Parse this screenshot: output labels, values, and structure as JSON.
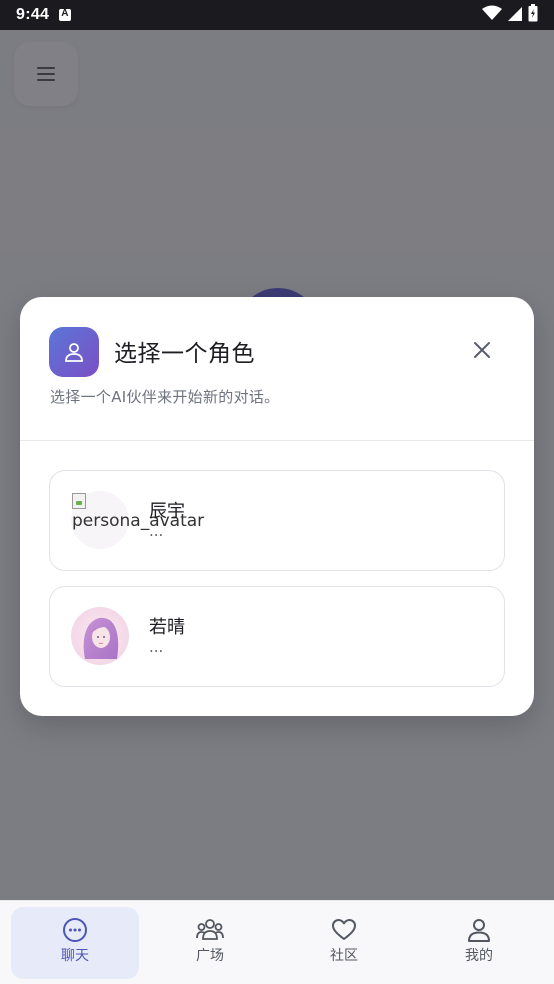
{
  "status_bar": {
    "time": "9:44",
    "icons": [
      "notification-a-icon",
      "wifi-icon",
      "signal-icon",
      "battery-icon"
    ]
  },
  "dialog": {
    "title": "选择一个角色",
    "subtitle": "选择一个AI伙伴来开始新的对话。",
    "icon": "person-icon",
    "close_icon": "close-icon",
    "personas": [
      {
        "name": "辰宇",
        "description": "...",
        "avatar_alt": "persona_avatar",
        "avatar_state": "broken-image"
      },
      {
        "name": "若晴",
        "description": "...",
        "avatar_state": "loaded-illustration"
      }
    ]
  },
  "bottom_nav": {
    "items": [
      {
        "label": "聊天",
        "icon": "chat-bubble-icon",
        "active": true
      },
      {
        "label": "广场",
        "icon": "group-icon",
        "active": false
      },
      {
        "label": "社区",
        "icon": "heart-icon",
        "active": false
      },
      {
        "label": "我的",
        "icon": "profile-icon",
        "active": false
      }
    ]
  },
  "colors": {
    "accent": "#4d55b4",
    "dialog_icon_gradient_start": "#5b76d6",
    "dialog_icon_gradient_end": "#7b4fc4",
    "overlay": "rgba(20,20,26,0.52)"
  }
}
